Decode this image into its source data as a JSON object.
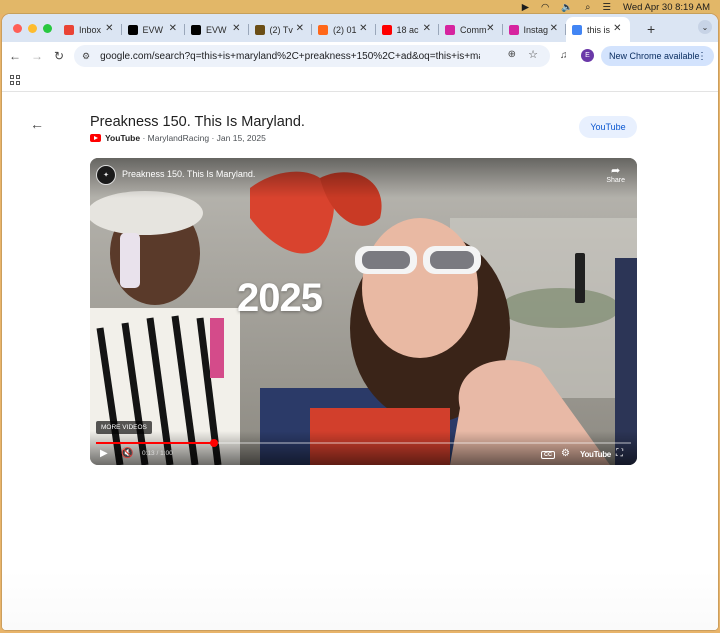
{
  "menubar": {
    "datetime": "Wed Apr 30  8:19 AM"
  },
  "tabs": [
    {
      "title": "Inbox",
      "icon": "gmail-icon",
      "color": "#ea4335"
    },
    {
      "title": "EVW",
      "icon": "x-icon",
      "color": "#000000"
    },
    {
      "title": "EVW",
      "icon": "x-icon",
      "color": "#000000"
    },
    {
      "title": "(2) Tv",
      "icon": "tv-icon",
      "color": "#6b4e16"
    },
    {
      "title": "(2) 01",
      "icon": "substack-icon",
      "color": "#ff6719"
    },
    {
      "title": "18 ac",
      "icon": "youtube-icon",
      "color": "#ff0000"
    },
    {
      "title": "Comm",
      "icon": "instagram-icon",
      "color": "#d6249f"
    },
    {
      "title": "Instag",
      "icon": "instagram-icon",
      "color": "#d6249f"
    },
    {
      "title": "this is",
      "icon": "google-icon",
      "color": "#4285f4",
      "active": true
    }
  ],
  "toolbar": {
    "url": "google.com/search?q=this+is+maryland%2C+preakness+150%2C+ad&oq=this+is+maryland...",
    "profile_initial": "E",
    "update_label": "New Chrome available"
  },
  "result": {
    "title": "Preakness 150. This Is Maryland.",
    "source": "YouTube",
    "channel": "MarylandRacing",
    "date": "Jan 15, 2025",
    "open_button": "YouTube"
  },
  "video": {
    "title": "Preakness 150. This Is Maryland.",
    "share_label": "Share",
    "overlay_text": "2025",
    "more_videos": "MORE VIDEOS",
    "time": "0:13 / 1:00",
    "progress": 0.22,
    "cc_label": "CC",
    "brand": "YouTube"
  },
  "colors": {
    "accent": "#ff0000",
    "link": "#0b57d0",
    "tabstrip": "#dbe5f3"
  }
}
